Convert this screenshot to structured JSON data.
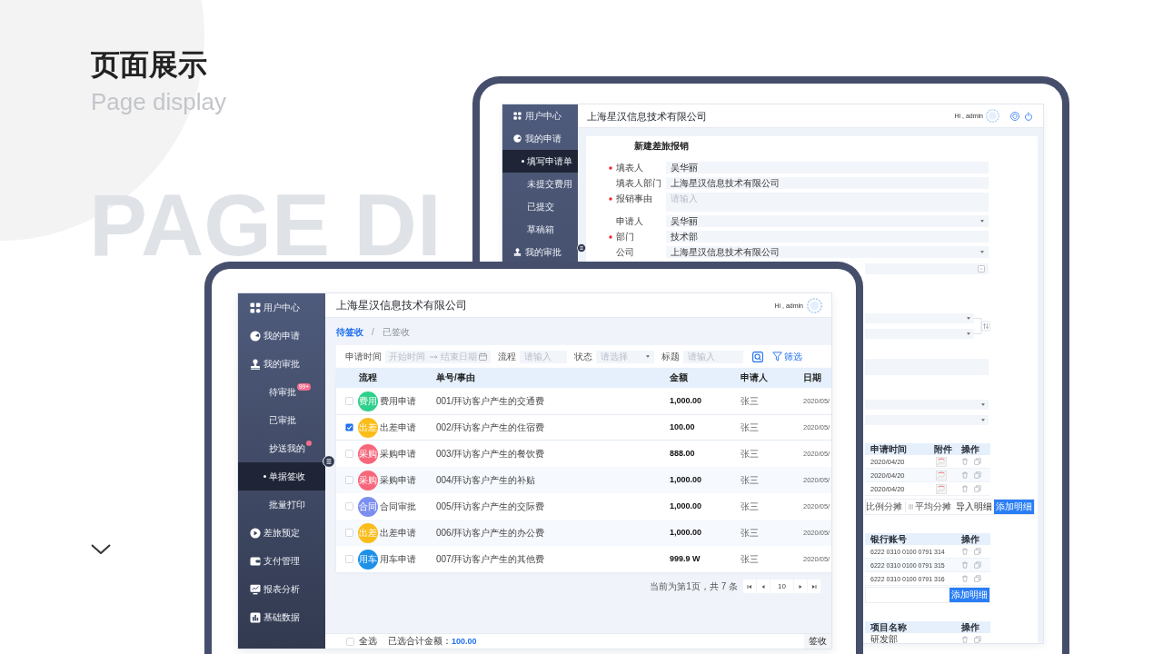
{
  "slide": {
    "title": "页面展示",
    "subtitle": "Page display",
    "background_text": "PAGE DI"
  },
  "back_window": {
    "sidebar": {
      "items": [
        {
          "label": "用户中心",
          "selected": false
        },
        {
          "label": "我的申请",
          "selected": false,
          "children": [
            {
              "label": "填写申请单",
              "selected": true
            },
            {
              "label": "未提交费用",
              "selected": false
            },
            {
              "label": "已提交",
              "selected": false
            },
            {
              "label": "草稿箱",
              "selected": false
            }
          ]
        },
        {
          "label": "我的审批",
          "selected": false
        }
      ]
    },
    "header": {
      "title": "上海星汉信息技术有限公司",
      "greeting": "Hi , admin"
    },
    "form": {
      "title": "新建差旅报销",
      "fields": [
        {
          "label": "填表人",
          "required": true,
          "kind": "input",
          "value": "吴华丽"
        },
        {
          "label": "填表人部门",
          "required": false,
          "kind": "input",
          "value": "上海星汉信息技术有限公司"
        },
        {
          "label": "报销事由",
          "required": true,
          "kind": "textarea",
          "placeholder": "请输入"
        },
        {
          "label": "申请人",
          "required": false,
          "kind": "select",
          "value": "吴华丽"
        },
        {
          "label": "部门",
          "required": true,
          "kind": "input",
          "value": "技术部"
        },
        {
          "label": "公司",
          "required": false,
          "kind": "select",
          "value": "上海星汉信息技术有限公司"
        }
      ]
    },
    "form_partial": {
      "fields": [
        {
          "kind": "date"
        },
        {
          "kind": "swap"
        },
        {
          "kind": "textarea"
        },
        {
          "kind": "select"
        },
        {
          "kind": "select"
        }
      ],
      "blocks": [
        {
          "kind": "table",
          "columns": [
            {
              "label": "申请时间",
              "kind": "date"
            },
            {
              "label": "附件",
              "kind": "attachment"
            },
            {
              "label": "操作",
              "kind": "actions"
            }
          ],
          "rows": [
            {
              "cells": [
                "2020/04/20"
              ]
            },
            {
              "cells": [
                "2020/04/20"
              ]
            },
            {
              "cells": [
                "2020/04/20"
              ]
            }
          ]
        },
        {
          "kind": "toolbar",
          "items": [
            {
              "kind": "text",
              "label": "比例分摊"
            },
            {
              "kind": "option",
              "label": "平均分摊"
            },
            {
              "kind": "button",
              "label": "导入明细"
            },
            {
              "kind": "primary",
              "label": "添加明细"
            }
          ]
        },
        {
          "kind": "table",
          "columns": [
            {
              "label": "银行账号",
              "kind": "number"
            },
            {
              "label": "操作",
              "kind": "actions"
            }
          ],
          "rows": [
            {
              "cells": [
                "6222 0310 0100 0791 314"
              ]
            },
            {
              "cells": [
                "6222 0310 0100 0791 315"
              ]
            },
            {
              "cells": [
                "6222 0310 0100 0791 316"
              ]
            }
          ]
        },
        {
          "kind": "toolbar",
          "items": [
            {
              "kind": "primary",
              "label": "添加明细"
            }
          ]
        },
        {
          "kind": "table",
          "columns": [
            {
              "label": "项目名称",
              "kind": "text"
            },
            {
              "label": "操作",
              "kind": "actions"
            }
          ],
          "rows": [
            {
              "cells": [
                "研发部"
              ]
            }
          ]
        }
      ]
    }
  },
  "front_window": {
    "sidebar": {
      "items": [
        {
          "label": "用户中心",
          "selected": false
        },
        {
          "label": "我的申请",
          "selected": false
        },
        {
          "label": "我的审批",
          "selected": false,
          "children": [
            {
              "label": "待审批",
              "selected": false,
              "badge": "99+"
            },
            {
              "label": "已审批",
              "selected": false
            },
            {
              "label": "抄送我的",
              "selected": false,
              "dot": true
            },
            {
              "label": "单据签收",
              "selected": true
            },
            {
              "label": "批量打印",
              "selected": false
            }
          ]
        },
        {
          "label": "差旅预定",
          "selected": false
        },
        {
          "label": "支付管理",
          "selected": false
        },
        {
          "label": "报表分析",
          "selected": false
        },
        {
          "label": "基础数据",
          "selected": false
        }
      ]
    },
    "header": {
      "title": "上海星汉信息技术有限公司",
      "greeting": "Hi , admin"
    },
    "tabs": [
      {
        "label": "待签收",
        "selected": true
      },
      {
        "label": "已签收",
        "selected": false
      }
    ],
    "tab_separator": "/",
    "filters": [
      {
        "kind": "daterange",
        "label": "申请时间",
        "start_placeholder": "开始时间",
        "end_placeholder": "结束日期"
      },
      {
        "kind": "input",
        "label": "流程",
        "placeholder": "请输入"
      },
      {
        "kind": "select",
        "label": "状态",
        "placeholder": "请选择"
      },
      {
        "kind": "input",
        "label": "标题",
        "placeholder": "请输入"
      }
    ],
    "filter_button": "筛选",
    "table": {
      "columns": [
        "流程",
        "单号/事由",
        "金额",
        "申请人",
        "日期"
      ],
      "rows": [
        {
          "checked": false,
          "tag": "费用",
          "color": "#2ed18b",
          "process": "费用申请",
          "reference": "001/拜访客户产生的交通费",
          "amount": "1,000.00",
          "applicant": "张三",
          "date": "2020/05/"
        },
        {
          "checked": true,
          "tag": "出差",
          "color": "#fbbd1a",
          "process": "出差申请",
          "reference": "002/拜访客户产生的住宿费",
          "amount": "100.00",
          "applicant": "张三",
          "date": "2020/05/"
        },
        {
          "checked": false,
          "tag": "采购",
          "color": "#f7667a",
          "process": "采购申请",
          "reference": "003/拜访客户产生的餐饮费",
          "amount": "888.00",
          "applicant": "张三",
          "date": "2020/05/"
        },
        {
          "checked": false,
          "tag": "采购",
          "color": "#f7667a",
          "process": "采购申请",
          "reference": "004/拜访客户产生的补贴",
          "amount": "1,000.00",
          "applicant": "张三",
          "date": "2020/05/"
        },
        {
          "checked": false,
          "tag": "合同",
          "color": "#7b8ff0",
          "process": "合同审批",
          "reference": "005/拜访客户产生的交际费",
          "amount": "1,000.00",
          "applicant": "张三",
          "date": "2020/05/"
        },
        {
          "checked": false,
          "tag": "出差",
          "color": "#fbbd1a",
          "process": "出差申请",
          "reference": "006/拜访客户产生的办公费",
          "amount": "1,000.00",
          "applicant": "张三",
          "date": "2020/05/"
        },
        {
          "checked": false,
          "tag": "用车",
          "color": "#1e90e8",
          "process": "用车申请",
          "reference": "007/拜访客户产生的其他费",
          "amount": "999.9 W",
          "applicant": "张三",
          "date": "2020/05/"
        }
      ]
    },
    "pagination": {
      "summary": "当前为第1页，共 7 条",
      "page_size": "10"
    },
    "footer": {
      "select_all": {
        "label": "全选",
        "checked": false
      },
      "total_label": "已选合计金额：",
      "total": "100.00",
      "action": "签收"
    }
  }
}
